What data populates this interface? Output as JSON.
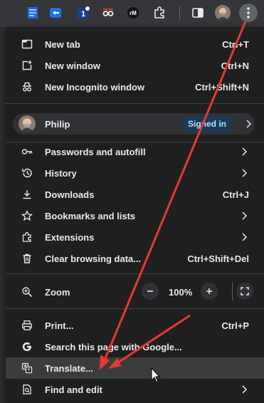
{
  "toolbar": {
    "extension_icons": [
      "blue-doc-icon",
      "translate-ext-icon",
      "notification-1-icon",
      "spy-glasses-icon",
      "rm-icon",
      "puzzle-icon"
    ],
    "badge_count": "1",
    "rm_label": "rM"
  },
  "menu": {
    "new_tab": {
      "label": "New tab",
      "shortcut": "Ctrl+T"
    },
    "new_window": {
      "label": "New window",
      "shortcut": "Ctrl+N"
    },
    "incognito": {
      "label": "New Incognito window",
      "shortcut": "Ctrl+Shift+N"
    },
    "profile": {
      "name": "Philip",
      "status": "Signed in"
    },
    "passwords": {
      "label": "Passwords and autofill"
    },
    "history": {
      "label": "History"
    },
    "downloads": {
      "label": "Downloads",
      "shortcut": "Ctrl+J"
    },
    "bookmarks": {
      "label": "Bookmarks and lists"
    },
    "extensions": {
      "label": "Extensions"
    },
    "clear": {
      "label": "Clear browsing data...",
      "shortcut": "Ctrl+Shift+Del"
    },
    "zoom": {
      "label": "Zoom",
      "value": "100%"
    },
    "print": {
      "label": "Print...",
      "shortcut": "Ctrl+P"
    },
    "search_page": {
      "label": "Search this page with Google..."
    },
    "translate": {
      "label": "Translate..."
    },
    "find_edit": {
      "label": "Find and edit"
    }
  },
  "annotation": {
    "arrow_color": "#e53935"
  }
}
